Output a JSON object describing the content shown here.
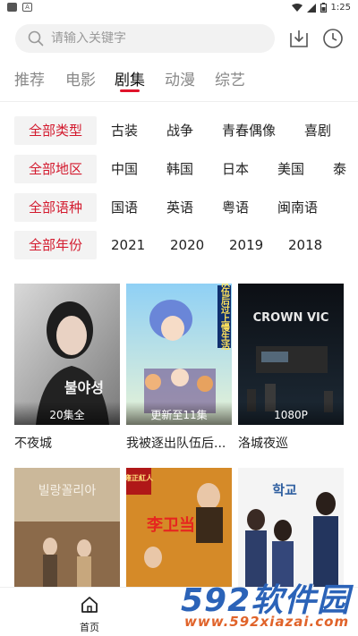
{
  "status_bar": {
    "time": "1:25"
  },
  "search": {
    "placeholder": "请输入关键字"
  },
  "tabs": [
    {
      "label": "推荐"
    },
    {
      "label": "电影"
    },
    {
      "label": "剧集",
      "active": true
    },
    {
      "label": "动漫"
    },
    {
      "label": "综艺"
    }
  ],
  "filters": {
    "type": {
      "label": "全部类型",
      "options": [
        "古装",
        "战争",
        "青春偶像",
        "喜剧"
      ]
    },
    "region": {
      "label": "全部地区",
      "options": [
        "中国",
        "韩国",
        "日本",
        "美国",
        "泰"
      ]
    },
    "language": {
      "label": "全部语种",
      "options": [
        "国语",
        "英语",
        "粤语",
        "闽南语"
      ]
    },
    "year": {
      "label": "全部年份",
      "options": [
        "2021",
        "2020",
        "2019",
        "2018"
      ]
    }
  },
  "cards": [
    {
      "title": "不夜城",
      "badge": "20集全"
    },
    {
      "title": "我被逐出队伍后...",
      "badge": "更新至11集"
    },
    {
      "title": "洛城夜巡",
      "badge": "1080P"
    },
    {
      "title": "",
      "badge": ""
    },
    {
      "title": "",
      "badge": ""
    },
    {
      "title": "",
      "badge": ""
    }
  ],
  "poster_texts": {
    "card1_logo": "불야성",
    "card2_banner": "我被逐出队伍后过上慢生活",
    "card3_title": "CROWN VIC",
    "card4_title": "빌랑꼴리아",
    "card5_title": "李卫当官",
    "card5_tag": "雍正紅人",
    "card6_title": "학교"
  },
  "bottom_nav": {
    "home_label": "首页"
  },
  "watermark": {
    "brand": "592软件园",
    "url": "www.592xiazai.com"
  },
  "colors": {
    "accent": "#e0132b",
    "label_bg": "#f3f3f3",
    "label_text": "#d31a2e"
  }
}
